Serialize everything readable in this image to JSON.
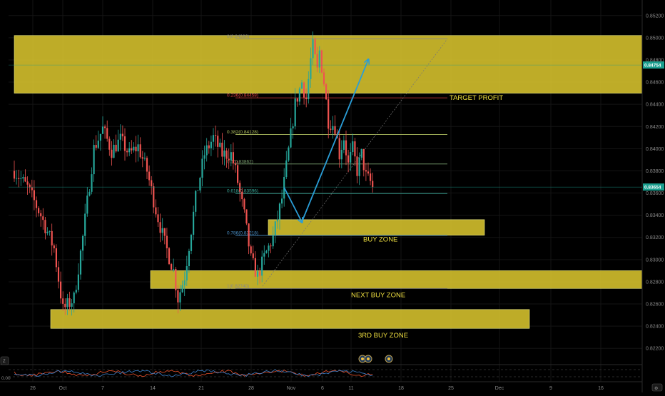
{
  "chart_data": {
    "type": "candlestick",
    "y_axis": {
      "range": [
        0.8206,
        0.8534
      ],
      "ticks": [
        "0.85200",
        "0.85000",
        "0.84800",
        "0.84600",
        "0.84400",
        "0.84200",
        "0.84000",
        "0.83800",
        "0.83600",
        "0.83400",
        "0.83200",
        "0.83000",
        "0.82800",
        "0.82600",
        "0.82400",
        "0.82200"
      ]
    },
    "x_axis": {
      "ticks": [
        "26",
        "Oct",
        "7",
        "14",
        "21",
        "28",
        "Nov",
        "6",
        "11",
        "18",
        "25",
        "Dec",
        "9",
        "16"
      ]
    },
    "price_tags": [
      {
        "label": "0.84754",
        "price": 0.84754,
        "color": "#1a9e8e"
      },
      {
        "label": "0.83654",
        "price": 0.83654,
        "color": "#1a9e8e"
      }
    ],
    "zones": [
      {
        "name": "target-zone",
        "label": "TARGET PROFIT",
        "top": 0.8502,
        "bottom": 0.845
      },
      {
        "name": "buy-zone",
        "label": "BUY ZONE",
        "top": 0.8336,
        "bottom": 0.8322
      },
      {
        "name": "next-buy-zone",
        "label": "NEXT BUY ZONE",
        "top": 0.829,
        "bottom": 0.8274
      },
      {
        "name": "third-buy-zone",
        "label": "3RD BUY ZONE",
        "top": 0.8255,
        "bottom": 0.8238
      }
    ],
    "fib_levels": [
      {
        "label": "0(0.84990)",
        "price": 0.8499,
        "color": "#888888"
      },
      {
        "label": "0.236(0.84458)",
        "price": 0.84458,
        "color": "#e04040"
      },
      {
        "label": "0.382(0.84128)",
        "price": 0.84128,
        "color": "#b0c060"
      },
      {
        "label": "0.5(0.83862)",
        "price": 0.83862,
        "color": "#7aa070"
      },
      {
        "label": "0.618(0.83596)",
        "price": 0.83596,
        "color": "#3aaa9a"
      },
      {
        "label": "0.786(0.83218)",
        "price": 0.83218,
        "color": "#4a90c8"
      },
      {
        "label": "1(0.82740)",
        "price": 0.8274,
        "color": "#888888"
      }
    ],
    "projection": [
      {
        "bar": 122,
        "price": 0.8365
      },
      {
        "bar": 130,
        "price": 0.8334
      },
      {
        "bar": 160,
        "price": 0.848
      }
    ],
    "candles": [],
    "indicator": {
      "zero_label": "0.00",
      "colors": [
        "#e8502a",
        "#3a7ec8"
      ]
    },
    "colors": {
      "up": "#26a69a",
      "down": "#ef5350",
      "zone": "#d8c42e",
      "arrow": "#2a9ed8",
      "zone_text": "#f0e040"
    }
  },
  "ui": {
    "corner_button_left": "Z",
    "corner_button_right": "⚙"
  }
}
